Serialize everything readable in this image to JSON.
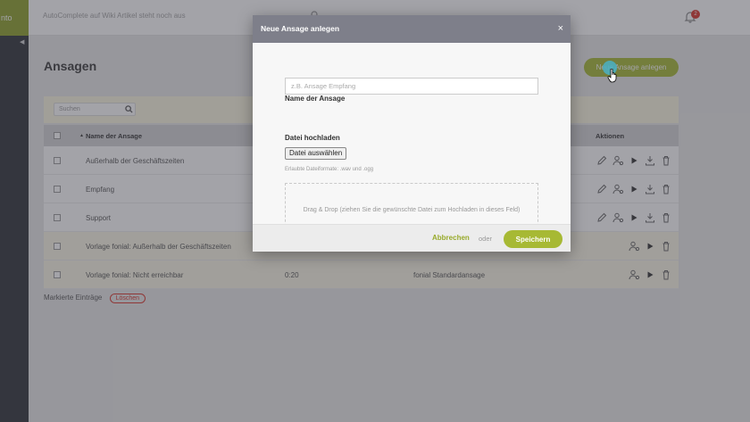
{
  "sidebar": {
    "logo_text": "nto",
    "collapse_glyph": "◀"
  },
  "header": {
    "search_placeholder": "AutoComplete auf Wiki Artikel steht noch aus",
    "notification_count": "2"
  },
  "page": {
    "title": "Ansagen",
    "new_button_label": "Neue Ansage anlegen",
    "filter_search_placeholder": "Suchen"
  },
  "table": {
    "headers": {
      "name": "Name der Ansage",
      "sort_glyph": "▲",
      "actions": "Aktionen"
    },
    "rows": [
      {
        "name": "Außerhalb der Geschäftszeiten",
        "duration": "",
        "category": ""
      },
      {
        "name": "Empfang",
        "duration": "",
        "category": ""
      },
      {
        "name": "Support",
        "duration": "",
        "category": ""
      },
      {
        "name": "Vorlage fonial: Außerhalb der Geschäftszeiten",
        "duration": "",
        "category": ""
      },
      {
        "name": "Vorlage fonial: Nicht erreichbar",
        "duration": "0:20",
        "category": "fonial Standardansage"
      }
    ]
  },
  "footer": {
    "marked_label": "Markierte Einträge",
    "delete_label": "Löschen"
  },
  "modal": {
    "title": "Neue Ansage anlegen",
    "close_glyph": "×",
    "name_label": "Name der Ansage",
    "name_placeholder": "z.B. Ansage Empfang",
    "upload_label": "Datei hochladen",
    "file_button": "Datei auswählen",
    "formats_hint": "Erlaubte Dateiformate: .wav und .ogg",
    "dropzone_text": "Drag & Drop (ziehen Sie die gewünschte Datei zum Hochladen in dieses Feld)",
    "cancel_label": "Abbrechen",
    "or_label": "oder",
    "save_label": "Speichern"
  },
  "colors": {
    "accent": "#a7b934",
    "sidebar": "#2f3137",
    "danger": "#d9342b",
    "modal_header": "#7e7f8a"
  }
}
